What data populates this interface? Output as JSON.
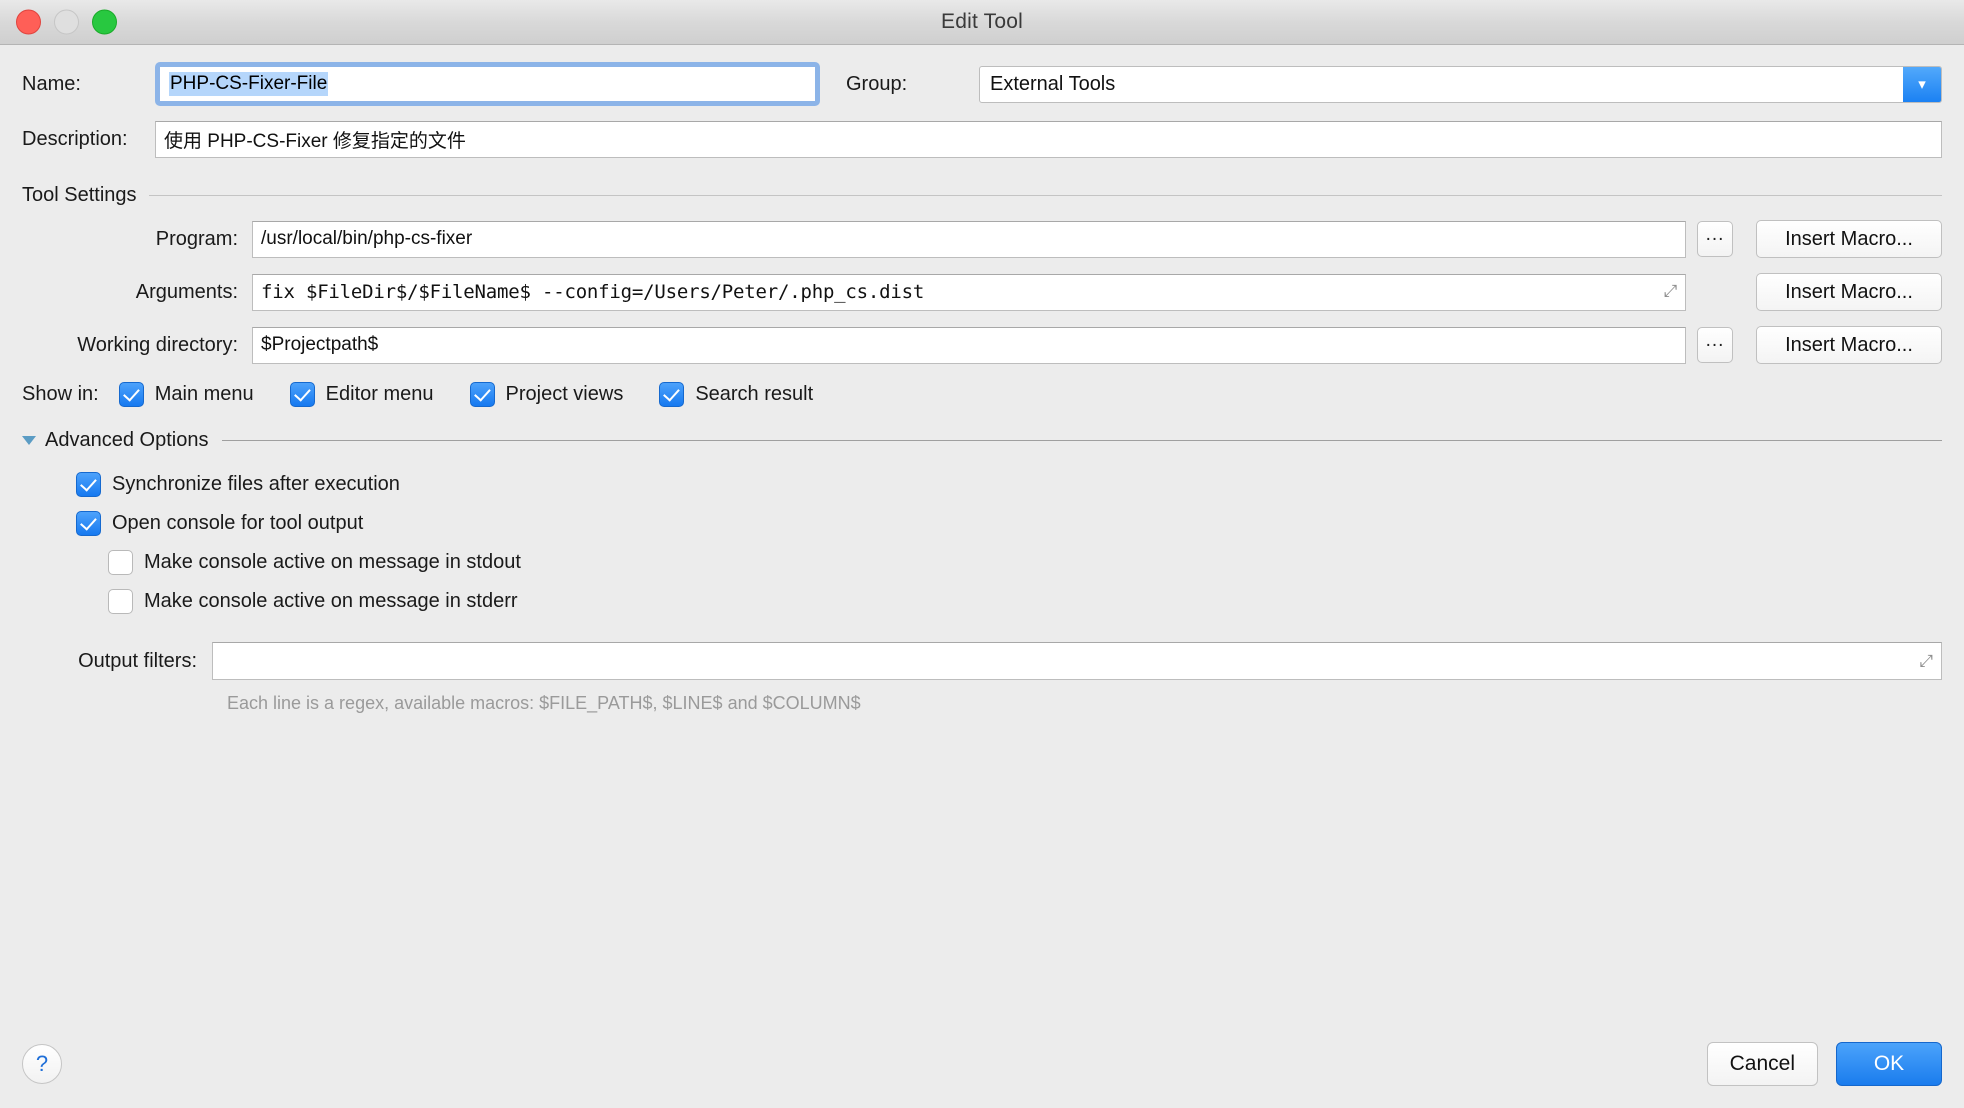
{
  "window": {
    "title": "Edit Tool",
    "traffic_lights": [
      "close",
      "minimize",
      "maximize"
    ]
  },
  "name_row": {
    "label": "Name:",
    "value": "PHP-CS-Fixer-File",
    "selected": true,
    "group_label": "Group:",
    "group_value": "External Tools",
    "group_arrow": "chevron-down-icon"
  },
  "description_row": {
    "label": "Description:",
    "value": "使用 PHP-CS-Fixer 修复指定的文件"
  },
  "tool_settings": {
    "title": "Tool Settings",
    "rows": [
      {
        "label": "Program:",
        "value": "/usr/local/bin/php-cs-fixer",
        "mono": false,
        "browse": "...",
        "macro": "Insert Macro...",
        "expand": false
      },
      {
        "label": "Arguments:",
        "value": "fix $FileDir$/$FileName$ --config=/Users/Peter/.php_cs.dist",
        "mono": true,
        "browse": null,
        "macro": "Insert Macro...",
        "expand": true
      },
      {
        "label": "Working directory:",
        "value": "$Projectpath$",
        "mono": false,
        "browse": "...",
        "macro": "Insert Macro...",
        "expand": false
      }
    ]
  },
  "show_in": {
    "label": "Show in:",
    "options": [
      {
        "label": "Main menu",
        "checked": true
      },
      {
        "label": "Editor menu",
        "checked": true
      },
      {
        "label": "Project views",
        "checked": true
      },
      {
        "label": "Search result",
        "checked": true
      }
    ]
  },
  "advanced": {
    "title": "Advanced Options",
    "expanded": true,
    "options": [
      {
        "label": "Synchronize files after execution",
        "checked": true,
        "nested": false
      },
      {
        "label": "Open console for tool output",
        "checked": true,
        "nested": false
      },
      {
        "label": "Make console active on message in stdout",
        "checked": false,
        "nested": true
      },
      {
        "label": "Make console active on message in stderr",
        "checked": false,
        "nested": true
      }
    ]
  },
  "output_filters": {
    "label": "Output filters:",
    "value": "",
    "hint": "Each line is a regex, available macros: $FILE_PATH$, $LINE$ and $COLUMN$"
  },
  "footer": {
    "help": "?",
    "cancel": "Cancel",
    "ok": "OK"
  },
  "colors": {
    "accent_blue": "#1a7ced",
    "selection_blue": "#b5d6fb",
    "focus_ring": "#8cb4e8",
    "window_bg": "#ececec",
    "triangle": "#5b9cc4"
  }
}
